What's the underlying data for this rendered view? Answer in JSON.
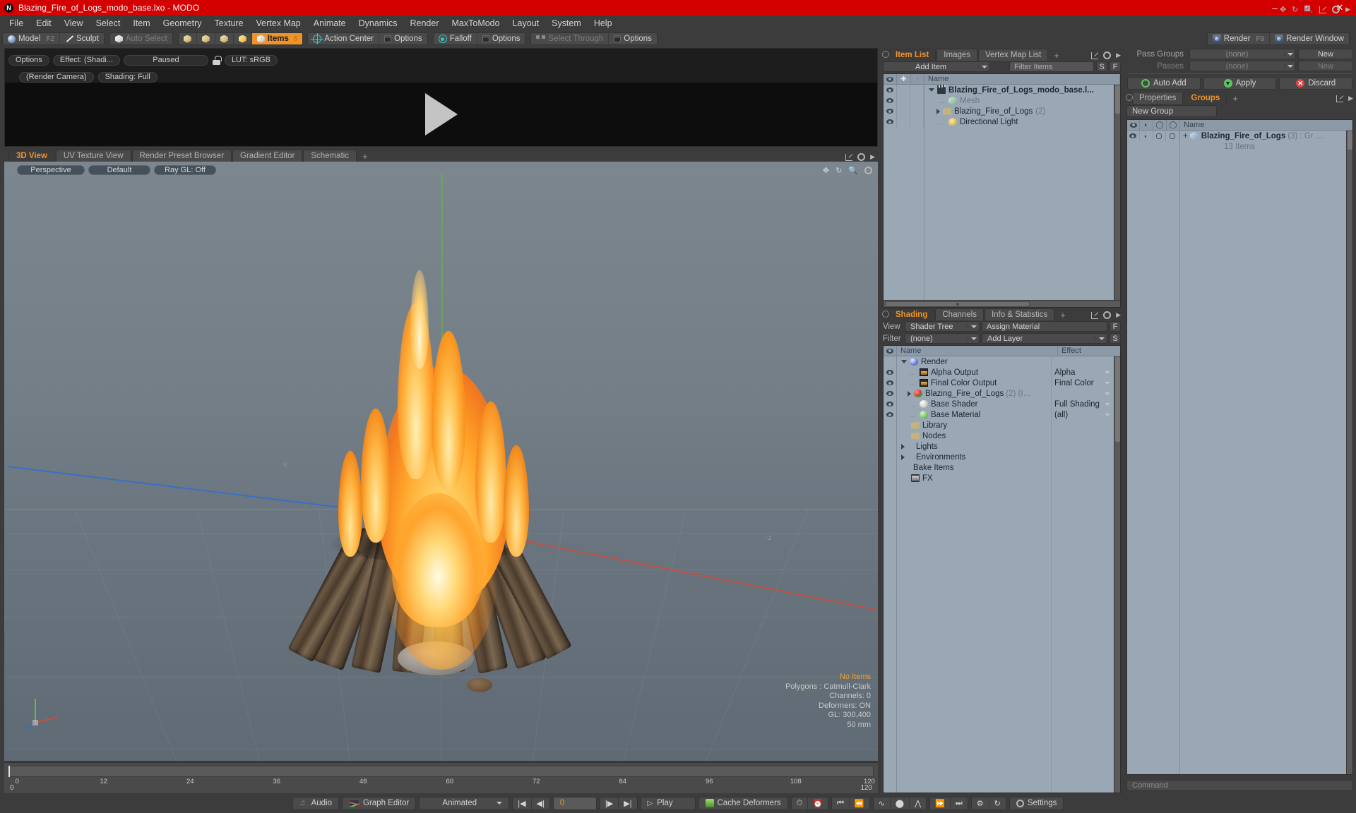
{
  "window": {
    "title": "Blazing_Fire_of_Logs_modo_base.lxo - MODO",
    "logo": "modo-logo",
    "minimize": "–",
    "maximize": "□",
    "close": "✕"
  },
  "menubar": [
    "File",
    "Edit",
    "View",
    "Select",
    "Item",
    "Geometry",
    "Texture",
    "Vertex Map",
    "Animate",
    "Dynamics",
    "Render",
    "MaxToModo",
    "Layout",
    "System",
    "Help"
  ],
  "modebar": {
    "model": "Model",
    "model_key": "F2",
    "sculpt": "Sculpt",
    "auto_select": "Auto Select",
    "items": "Items",
    "items_num": "5",
    "action_center": "Action Center",
    "options1": "Options",
    "falloff": "Falloff",
    "options2": "Options",
    "select_through": "Select Through",
    "options3": "Options",
    "render": "Render",
    "render_key": "F9",
    "render_window": "Render Window"
  },
  "preview": {
    "options": "Options",
    "effect": "Effect: (Shadi...",
    "paused": "Paused",
    "lut": "LUT: sRGB",
    "camera": "(Render Camera)",
    "shading": "Shading: Full"
  },
  "viewport": {
    "tabs": [
      "3D View",
      "UV Texture View",
      "Render Preset Browser",
      "Gradient Editor",
      "Schematic"
    ],
    "active_tab": "3D View",
    "add_tab": "+",
    "perspective": "Perspective",
    "default": "Default",
    "raygl": "Ray GL: Off",
    "axis_x": "-x",
    "axis_z": "-z",
    "info": {
      "no_items": "No Items",
      "polygons": "Polygons : Catmull-Clark",
      "channels": "Channels: 0",
      "deformers": "Deformers: ON",
      "gl": "GL: 300,400",
      "scale": "50 mm"
    }
  },
  "timeline": {
    "ticks": [
      "0",
      "12",
      "24",
      "36",
      "48",
      "60",
      "72",
      "84",
      "96",
      "108",
      "120"
    ],
    "start": "0",
    "end": "120"
  },
  "animbar": {
    "audio": "Audio",
    "graph_editor": "Graph Editor",
    "animated": "Animated",
    "frame": "0",
    "play": "Play",
    "cache_deformers": "Cache Deformers",
    "settings": "Settings",
    "first_frame": "|◀",
    "prev_frame": "◀|",
    "step": "◀▶",
    "next_frame": "|▶",
    "last_frame": "▶|"
  },
  "item_list": {
    "tabs": [
      "Item List",
      "Images",
      "Vertex Map List"
    ],
    "active_tab": "Item List",
    "add_tab": "+",
    "add_item": "Add Item",
    "filter_items": "Filter Items",
    "s": "S",
    "f": "F",
    "header_name": "Name",
    "rows": [
      {
        "label": "Blazing_Fire_of_Logs_modo_base.l...",
        "suffix": "",
        "icon": "slate-icon",
        "depth": 0,
        "bold": true,
        "muted": false,
        "toggle": "down"
      },
      {
        "label": "Mesh",
        "suffix": "",
        "icon": "mesh-icon",
        "depth": 1,
        "bold": false,
        "muted": true,
        "toggle": "none"
      },
      {
        "label": "Blazing_Fire_of_Logs",
        "suffix": "(2)",
        "icon": "folder-icon",
        "depth": 1,
        "bold": false,
        "muted": false,
        "toggle": "right"
      },
      {
        "label": "Directional Light",
        "suffix": "",
        "icon": "light-icon",
        "depth": 1,
        "bold": false,
        "muted": false,
        "toggle": "none"
      }
    ]
  },
  "shading": {
    "tabs": [
      "Shading",
      "Channels",
      "Info & Statistics"
    ],
    "active_tab": "Shading",
    "add_tab": "+",
    "view_label": "View",
    "view_value": "Shader Tree",
    "assign_material": "Assign Material",
    "f": "F",
    "filter_label": "Filter",
    "filter_value": "(none)",
    "add_layer": "Add Layer",
    "s": "S",
    "header_name": "Name",
    "header_effect": "Effect",
    "rows": [
      {
        "label": "Render",
        "suffix": "",
        "effect": "",
        "icon": "ball-blue-icon",
        "depth": 0,
        "toggle": "down",
        "eye": false,
        "dropdown": false
      },
      {
        "label": "Alpha Output",
        "suffix": "",
        "effect": "Alpha",
        "icon": "image-icon",
        "depth": 1,
        "toggle": "none",
        "eye": true,
        "dropdown": true
      },
      {
        "label": "Final Color Output",
        "suffix": "",
        "effect": "Final Color",
        "icon": "image-icon",
        "depth": 1,
        "toggle": "none",
        "eye": true,
        "dropdown": true
      },
      {
        "label": "Blazing_Fire_of_Logs",
        "suffix": "(2) (I…",
        "effect": "",
        "icon": "ball-redgreen-icon",
        "depth": 1,
        "toggle": "right",
        "eye": true,
        "dropdown": true
      },
      {
        "label": "Base Shader",
        "suffix": "",
        "effect": "Full Shading",
        "icon": "ball-white-icon",
        "depth": 1,
        "toggle": "none",
        "eye": true,
        "dropdown": true
      },
      {
        "label": "Base Material",
        "suffix": "",
        "effect": "(all)",
        "icon": "ball-green-icon",
        "depth": 1,
        "toggle": "none",
        "eye": true,
        "dropdown": true
      },
      {
        "label": "Library",
        "suffix": "",
        "effect": "",
        "icon": "folder-icon",
        "depth": 1,
        "toggle": "none",
        "eye": false,
        "dropdown": false
      },
      {
        "label": "Nodes",
        "suffix": "",
        "effect": "",
        "icon": "folder-icon",
        "depth": 1,
        "toggle": "none",
        "eye": false,
        "dropdown": false
      },
      {
        "label": "Lights",
        "suffix": "",
        "effect": "",
        "icon": "none",
        "depth": 0,
        "toggle": "right",
        "eye": false,
        "dropdown": false
      },
      {
        "label": "Environments",
        "suffix": "",
        "effect": "",
        "icon": "none",
        "depth": 0,
        "toggle": "right",
        "eye": false,
        "dropdown": false
      },
      {
        "label": "Bake Items",
        "suffix": "",
        "effect": "",
        "icon": "none",
        "depth": 0,
        "toggle": "none",
        "eye": false,
        "dropdown": false
      },
      {
        "label": "FX",
        "suffix": "",
        "effect": "",
        "icon": "fx-icon",
        "depth": 0,
        "toggle": "none",
        "eye": false,
        "dropdown": false
      }
    ]
  },
  "passes": {
    "pass_groups_label": "Pass Groups",
    "pass_groups_value": "(none)",
    "pass_groups_new": "New",
    "passes_label": "Passes",
    "passes_value": "(none)",
    "passes_new": "New",
    "auto_add": "Auto Add",
    "apply": "Apply",
    "discard": "Discard"
  },
  "groups": {
    "tabs": [
      "Properties",
      "Groups"
    ],
    "active_tab": "Groups",
    "add_tab": "+",
    "new_group": "New Group",
    "header_name": "Name",
    "row_name": "Blazing_Fire_of_Logs",
    "row_suffix": "(3) : Gr …",
    "row_sub": "13 Items",
    "plus": "+"
  },
  "command": {
    "placeholder": "Command"
  },
  "colors": {
    "titlebar": "#d40000",
    "accent": "#f0932b",
    "panel": "#3c3c3c",
    "control": "#4a4a4a",
    "tree_bg": "#9aa7b4",
    "viewport_bg": "#6e7a84"
  }
}
